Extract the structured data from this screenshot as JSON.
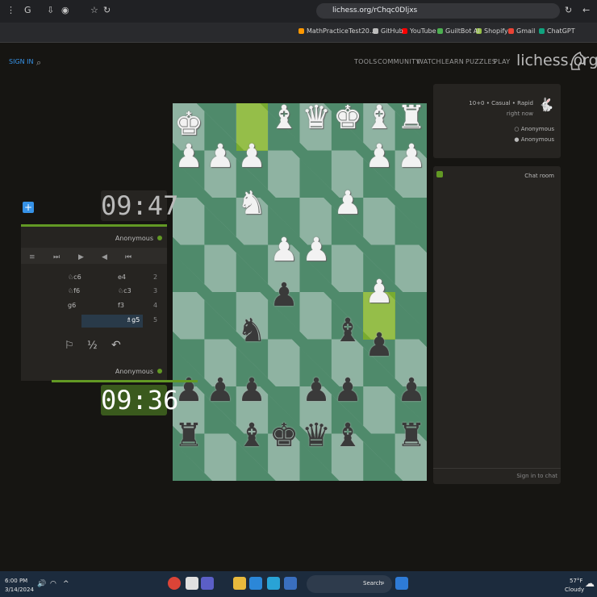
{
  "browser": {
    "url": "lichess.org/rChqc0Dljxs",
    "bookmarks": [
      "ChatGPT",
      "Gmail",
      "Shopify",
      "GuiltBot AI",
      "YouTube",
      "GitHub",
      "MathPracticeTest20..."
    ]
  },
  "site": {
    "logo": "lichess.org",
    "nav": [
      "PLAY",
      "PUZZLES",
      "LEARN",
      "WATCH",
      "COMMUNITY",
      "TOOLS"
    ],
    "sign_in": "SIGN IN"
  },
  "game_info": {
    "mode": "10+0 • Casual • Rapid",
    "time": "right now",
    "players": [
      "Anonymous",
      "Anonymous"
    ]
  },
  "chat": {
    "title": "Chat room",
    "placeholder": "Sign in to chat"
  },
  "clocks": {
    "top": "09:47",
    "bottom": "09:36"
  },
  "players": {
    "top": "Anonymous",
    "bottom": "Anonymous"
  },
  "moves": [
    {
      "n": "2",
      "white": "e4",
      "black": "♘c6"
    },
    {
      "n": "3",
      "white": "♘c3",
      "black": "♘f6"
    },
    {
      "n": "4",
      "white": "f3",
      "black": "g6"
    },
    {
      "n": "5",
      "white": "",
      "black": "♗g5"
    }
  ],
  "controls": {
    "half": "½"
  },
  "accent": {
    "green": "#629924",
    "blue": "#3692e7"
  },
  "taskbar": {
    "search": "Search",
    "time": "6:00 PM",
    "date": "3/14/2024",
    "weather": "57°F",
    "weather_desc": "Cloudy"
  }
}
